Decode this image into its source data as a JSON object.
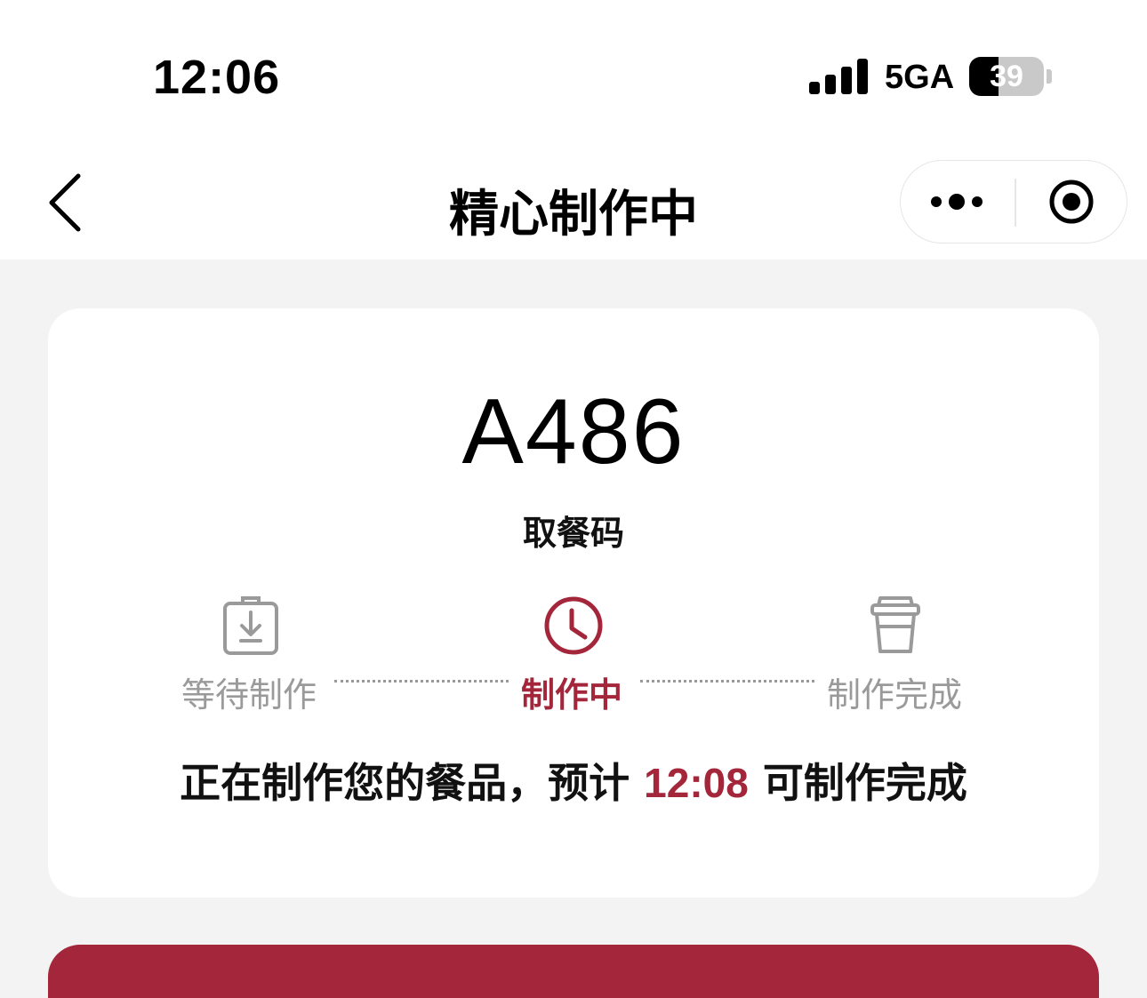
{
  "status_bar": {
    "time": "12:06",
    "network": "5GA",
    "battery": "39",
    "battery_level": 0.39
  },
  "nav": {
    "title": "精心制作中",
    "back_icon": "chevron-left-icon",
    "more_icon": "more-dots-icon",
    "close_icon": "target-circle-icon"
  },
  "order": {
    "pickup_code": "A486",
    "pickup_label": "取餐码",
    "steps": [
      {
        "label": "等待制作",
        "icon": "download-box-icon",
        "state": "done"
      },
      {
        "label": "制作中",
        "icon": "clock-icon",
        "state": "active"
      },
      {
        "label": "制作完成",
        "icon": "cup-icon",
        "state": "pending"
      }
    ],
    "status_prefix": "正在制作您的餐品，预计",
    "eta": "12:08",
    "status_suffix": "可制作完成"
  },
  "colors": {
    "accent": "#a4263a",
    "inactive": "#9a9a9a",
    "page_bg": "#f3f3f3"
  }
}
